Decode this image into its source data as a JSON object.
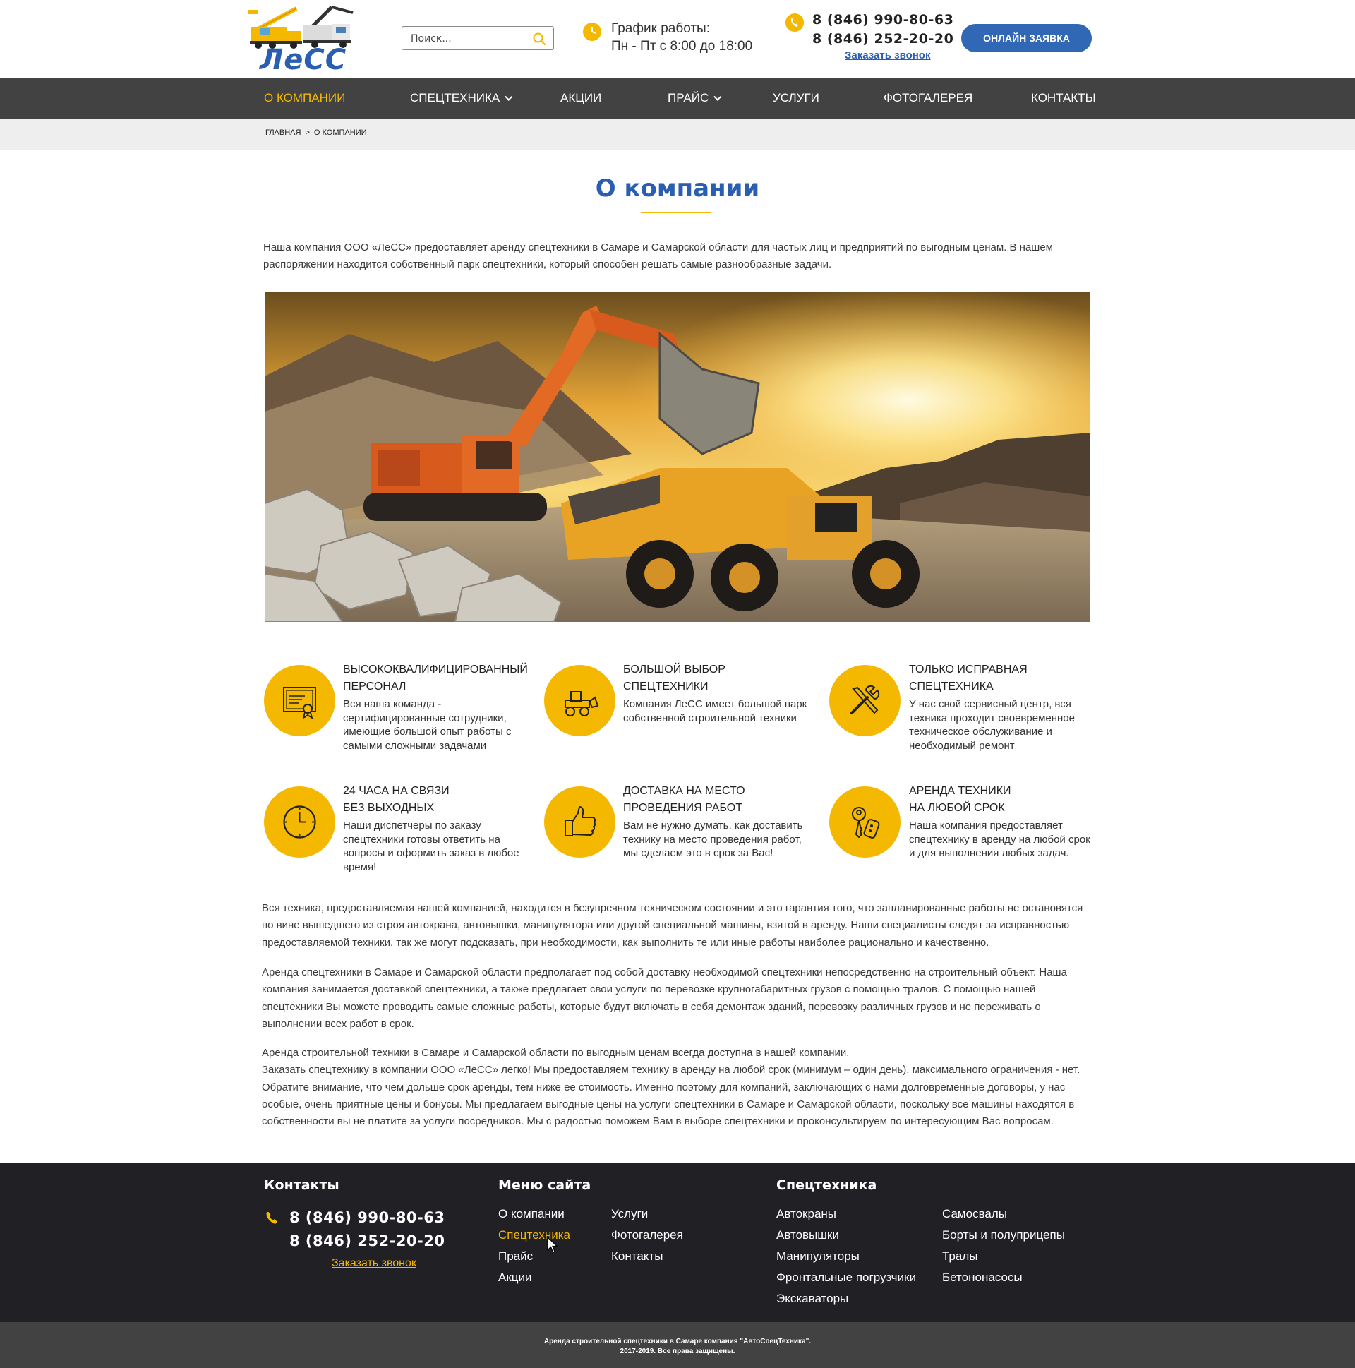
{
  "header": {
    "logo_text": "ЛеСС",
    "search_placeholder": "Поиск...",
    "schedule_title": "График работы:",
    "schedule_hours": "Пн - Пт с 8:00 до 18:00",
    "phone1": "8 (846) 990-80-63",
    "phone2": "8 (846) 252-20-20",
    "callback": "Заказать звонок",
    "order_button": "ОНЛАЙН ЗАЯВКА"
  },
  "nav": {
    "items": [
      {
        "label": "О КОМПАНИИ"
      },
      {
        "label": "СПЕЦТЕХНИКА"
      },
      {
        "label": "АКЦИИ"
      },
      {
        "label": "ПРАЙС"
      },
      {
        "label": "УСЛУГИ"
      },
      {
        "label": "ФОТОГАЛЕРЕЯ"
      },
      {
        "label": "КОНТАКТЫ"
      }
    ]
  },
  "breadcrumb": {
    "home": "ГЛАВНАЯ",
    "separator": ">",
    "current": "О КОМПАНИИ"
  },
  "page": {
    "title": "О компании",
    "intro_1": "Наша компания ООО «ЛеСС» предоставляет аренду спецтехники в Самаре и Самарской области для частых лиц и предприятий по выгодным ценам. В нашем",
    "intro_2": "распоряжении находится собственный  парк спецтехники, который способен решать самые разнообразные задачи."
  },
  "features": [
    {
      "icon": "certificate-icon",
      "title_1": "ВЫСОКОКВАЛИФИЦИРОВАННЫЙ",
      "title_2": "ПЕРСОНАЛ",
      "text_1": "Вся наша команда -",
      "text_2": "сертифицированные сотрудники,",
      "text_3": "имеющие большой опыт работы с",
      "text_4": "самыми сложными задачами"
    },
    {
      "icon": "loader-truck-icon",
      "title_1": "БОЛЬШОЙ ВЫБОР",
      "title_2": "СПЕЦТЕХНИКИ",
      "text_1": "Компания ЛеСС имеет большой парк",
      "text_2": "собственной строительной техники",
      "text_3": "",
      "text_4": ""
    },
    {
      "icon": "tools-icon",
      "title_1": "ТОЛЬКО ИСПРАВНАЯ",
      "title_2": "СПЕЦТЕХНИКА",
      "text_1": "У нас свой сервисный центр, вся",
      "text_2": "техника проходит своевременное",
      "text_3": "техническое обслуживание и",
      "text_4": "необходимый ремонт"
    },
    {
      "icon": "clock-icon",
      "title_1": "24 ЧАСА НА СВЯЗИ",
      "title_2": "БЕЗ ВЫХОДНЫХ",
      "text_1": "Наши диспетчеры по заказу",
      "text_2": "спецтехники готовы ответить на",
      "text_3": "вопросы и оформить заказ в любое",
      "text_4": "время!"
    },
    {
      "icon": "thumbs-up-icon",
      "title_1": "ДОСТАВКА НА МЕСТО",
      "title_2": "ПРОВЕДЕНИЯ РАБОТ",
      "text_1": "Вам не нужно думать, как доставить",
      "text_2": "технику на место проведения работ,",
      "text_3": "мы сделаем это в срок за Вас!",
      "text_4": ""
    },
    {
      "icon": "car-keys-icon",
      "title_1": "АРЕНДА ТЕХНИКИ",
      "title_2": "НА ЛЮБОЙ СРОК",
      "text_1": "Наша компания предоставляет",
      "text_2": "спецтехнику в аренду на любой срок",
      "text_3": "и для выполнения любых задач.",
      "text_4": ""
    }
  ],
  "body": {
    "p1_1": "Вся техника, предоставляемая нашей компанией, находится в безупречном техническом состоянии и  это гарантия того, что запланированные работы не остановятся",
    "p1_2": "по вине вышедшего из строя автокрана, автовышки, манипулятора или другой специальной машины, взятой в аренду. Наши специалисты  следят за исправностью",
    "p1_3": "предоставляемой техники, так же могут подсказать, при необходимости, как выполнить те или иные работы наиболее рационально и качественно.",
    "p2_1": "Аренда спецтехники в Самаре и Самарской области предполагает под собой доставку необходимой спецтехники непосредственно на строительный объект. Наша",
    "p2_2": "компания занимается доставкой спецтехники, а также предлагает свои услуги по перевозке крупногабаритных грузов с помощью тралов. С помощью нашей",
    "p2_3": "спецтехники  Вы можете проводить самые сложные работы, которые будут включать в себя демонтаж зданий, перевозку различных грузов и не переживать о",
    "p2_4": "выполнении всех работ в срок.",
    "p3_1": "Аренда строительной техники в Самаре и Самарской области по выгодным ценам всегда доступна в нашей компании.",
    "p3_2": "Заказать спецтехнику в компании ООО «ЛеСС» легко! Мы предоставляем технику в аренду на любой срок (минимум – один день), максимального ограничения - нет.",
    "p3_3": "Обратите внимание, что чем дольше срок аренды, тем ниже ее стоимость. Именно поэтому для компаний, заключающих с нами долговременные договоры, у нас",
    "p3_4": "особые, очень приятные цены и бонусы. Мы предлагаем выгодные цены на услуги спецтехники в Самаре и Самарской области, поскольку все машины находятся в",
    "p3_5": "собственности  вы не платите за услуги посредников. Мы с радостью поможем Вам в выборе спецтехники и проконсультируем по интересующим Вас вопросам."
  },
  "footer": {
    "contacts_title": "Контакты",
    "phone1": "8 (846) 990-80-63",
    "phone2": "8 (846) 252-20-20",
    "callback": "Заказать звонок",
    "menu_title": "Меню сайта",
    "menu_col1": [
      "О компании",
      "Спецтехника",
      "Прайс",
      "Акции"
    ],
    "menu_col2": [
      "Услуги",
      "Фотогалерея",
      "Контакты"
    ],
    "equip_title": "Спецтехника",
    "equip_col1": [
      "Автокраны",
      "Автовышки",
      "Манипуляторы",
      "Фронтальные погрузчики",
      "Экскаваторы"
    ],
    "equip_col2": [
      "Самосвалы",
      "Борты и полуприцепы",
      "Тралы",
      "Бетононасосы"
    ],
    "copyright_1": "Аренда строительной спецтехники в Самаре компания \"АвтоСпецТехника\".",
    "copyright_2": "2017-2019. Все права защищены."
  },
  "colors": {
    "accent": "#f5b800",
    "brand_blue": "#2a5eb0",
    "nav_bg": "#424242",
    "footer_bg": "#212025"
  }
}
